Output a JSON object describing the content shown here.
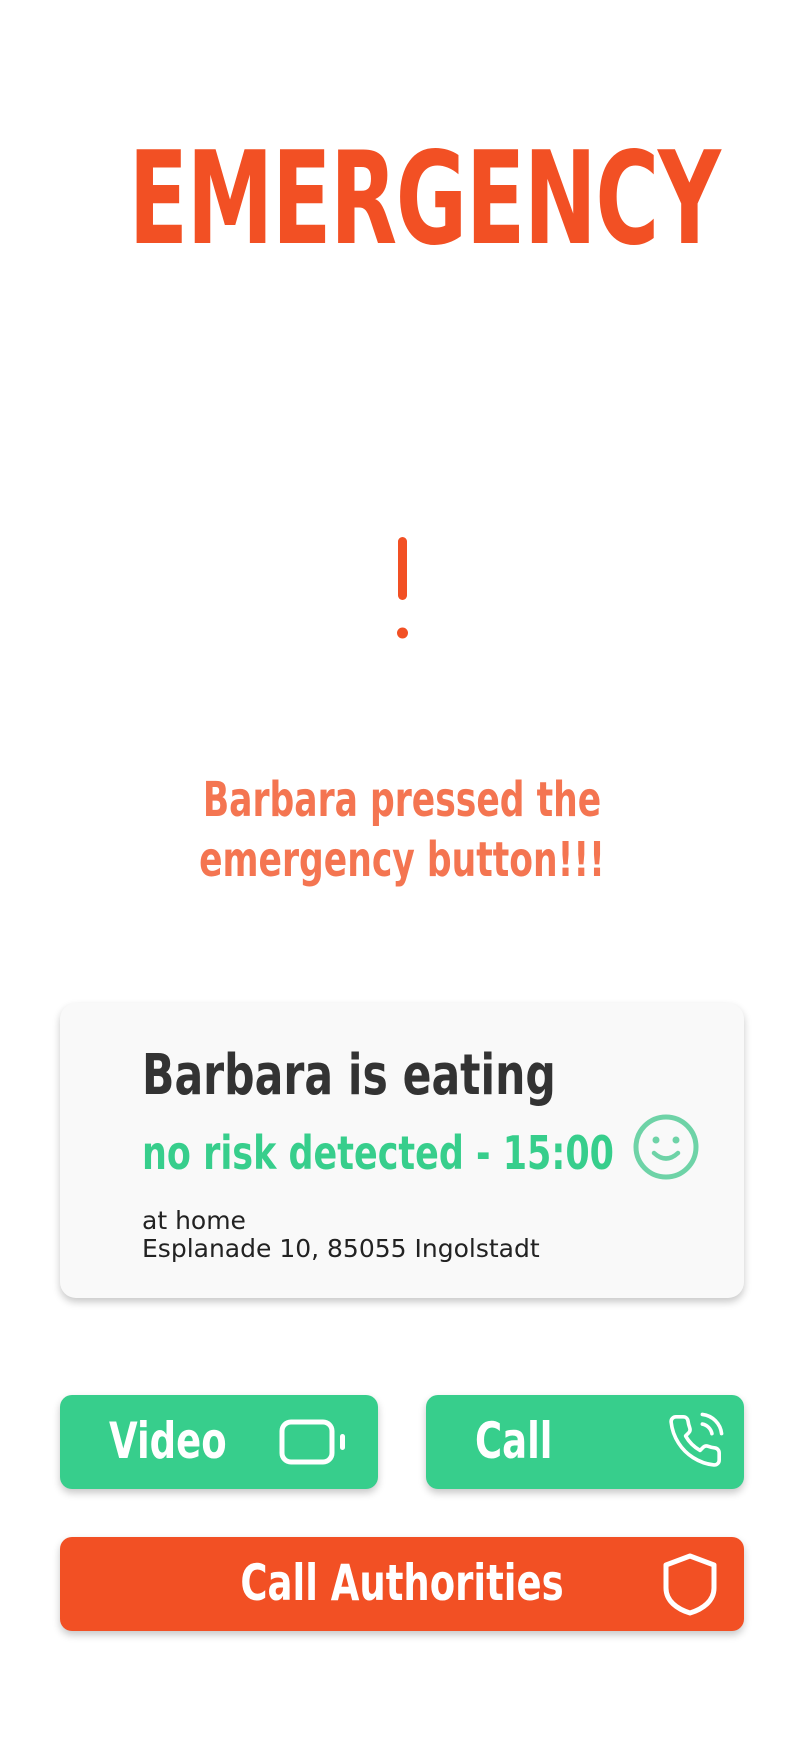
{
  "header": {
    "title": "EMERGENCY"
  },
  "alert": {
    "icon": "exclamation-icon",
    "message_line1": "Barbara pressed the",
    "message_line2": "emergency button!!!"
  },
  "status_card": {
    "title": "Barbara is eating",
    "status": "no risk detected - 15:00",
    "status_icon": "smiley-icon",
    "location_label": "at home",
    "address": "Esplanade 10, 85055 Ingolstadt"
  },
  "actions": {
    "video_label": "Video",
    "video_icon": "video-camera-icon",
    "call_label": "Call",
    "call_icon": "phone-call-icon",
    "authorities_label": "Call Authorities",
    "authorities_icon": "shield-icon"
  },
  "colors": {
    "alert_red": "#F25024",
    "alert_text": "#F47551",
    "safe_green": "#37CE8C",
    "card_background": "#F9F9F9",
    "text_dark": "#333333"
  }
}
